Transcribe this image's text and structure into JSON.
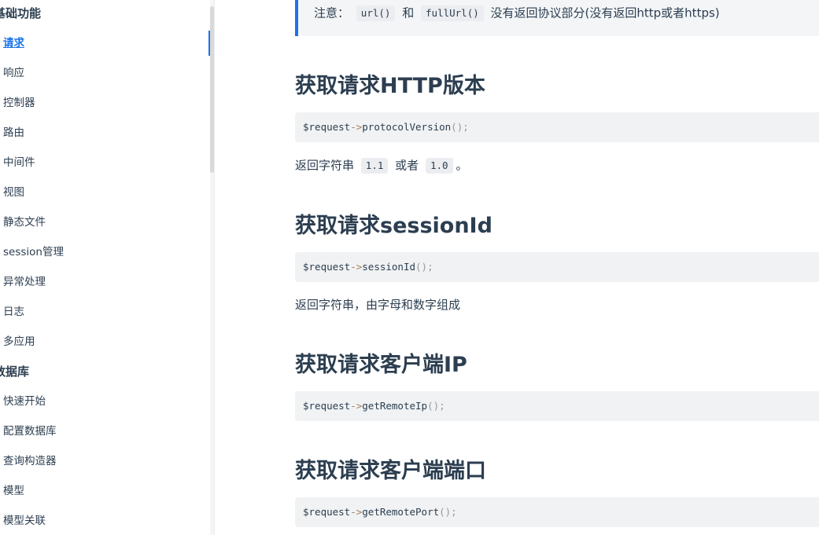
{
  "sidebar": {
    "groups": [
      {
        "title": "基础功能",
        "items": [
          {
            "label": "请求",
            "active": true
          },
          {
            "label": "响应"
          },
          {
            "label": "控制器"
          },
          {
            "label": "路由"
          },
          {
            "label": "中间件"
          },
          {
            "label": "视图"
          },
          {
            "label": "静态文件"
          },
          {
            "label": "session管理"
          },
          {
            "label": "异常处理"
          },
          {
            "label": "日志"
          },
          {
            "label": "多应用"
          }
        ]
      },
      {
        "title": "数据库",
        "items": [
          {
            "label": "快速开始"
          },
          {
            "label": "配置数据库"
          },
          {
            "label": "查询构造器"
          },
          {
            "label": "模型"
          },
          {
            "label": "模型关联"
          }
        ]
      }
    ]
  },
  "tip": {
    "prefix": "注意：",
    "code1": "url()",
    "middle": "和",
    "code2": "fullUrl()",
    "suffix": "没有返回协议部分(没有返回http或者https)"
  },
  "sections": [
    {
      "heading": "获取请求HTTP版本",
      "code": {
        "var": "$request",
        "op": "->",
        "fn": "protocolVersion",
        "punc": "();"
      },
      "desc": {
        "pre": "返回字符串",
        "code1": "1.1",
        "mid": "或者",
        "code2": "1.0",
        "post": "。"
      }
    },
    {
      "heading": "获取请求sessionId",
      "code": {
        "var": "$request",
        "op": "->",
        "fn": "sessionId",
        "punc": "();"
      },
      "desc_text": "返回字符串，由字母和数字组成"
    },
    {
      "heading": "获取请求客户端IP",
      "code": {
        "var": "$request",
        "op": "->",
        "fn": "getRemoteIp",
        "punc": "();"
      }
    },
    {
      "heading": "获取请求客户端端口",
      "code": {
        "var": "$request",
        "op": "->",
        "fn": "getRemotePort",
        "punc": "();"
      }
    }
  ],
  "colors": {
    "accent": "#1a73e8",
    "text": "#2c3e50",
    "code_bg": "#f0f2f3",
    "tip_bg": "#f3f5f7"
  }
}
